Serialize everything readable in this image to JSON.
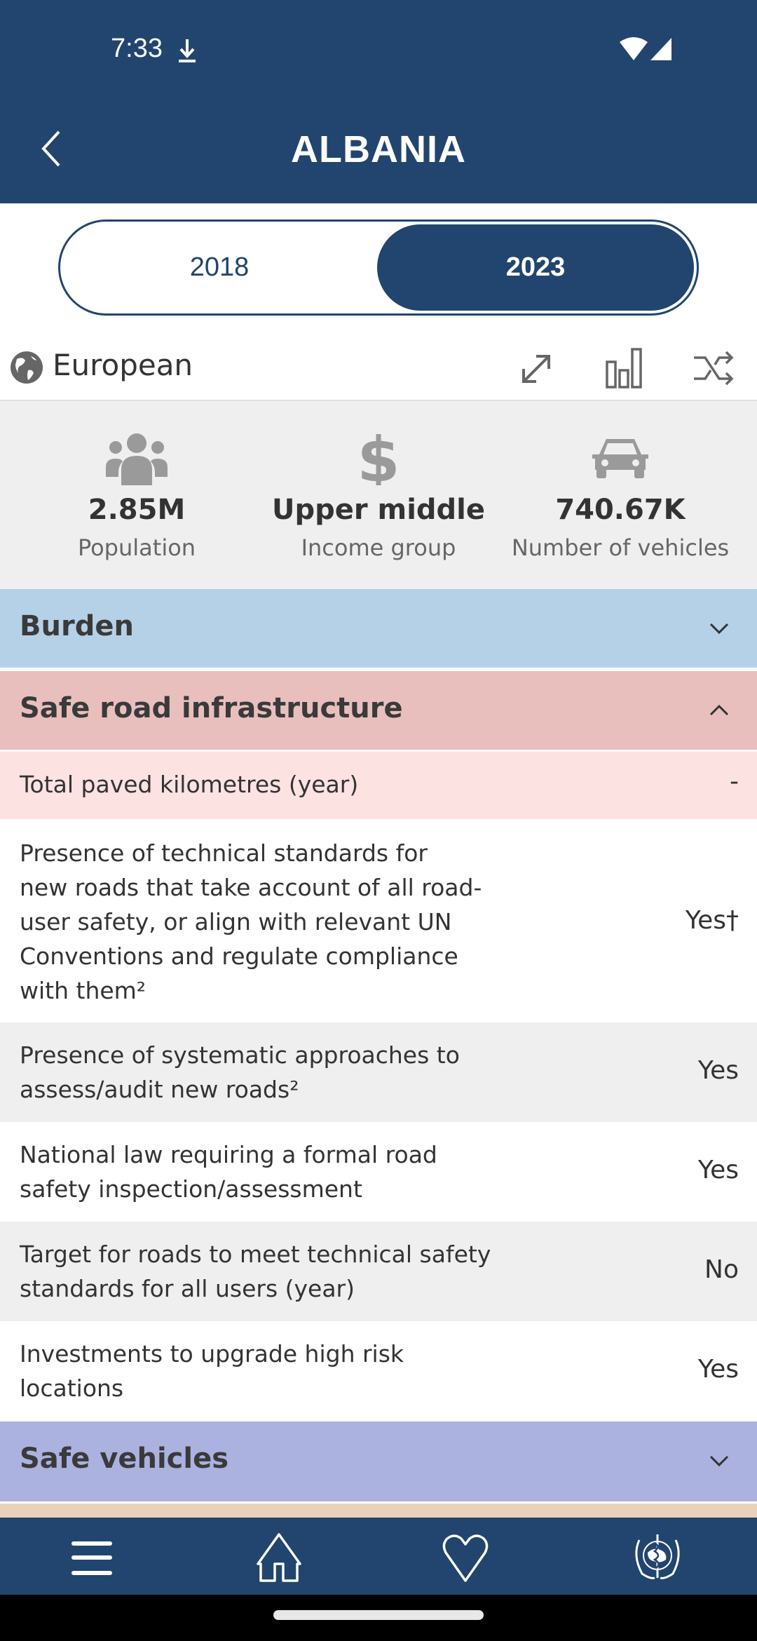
{
  "status_bar": {
    "time": "7:33",
    "icons": [
      "download-icon",
      "wifi-icon",
      "cell-signal-icon"
    ]
  },
  "app_bar": {
    "title": "ALBANIA",
    "back_icon": "chevron-left-icon"
  },
  "year_toggle": {
    "options": [
      "2018",
      "2023"
    ],
    "selected": "2023"
  },
  "region": {
    "icon": "globe-icon",
    "name": "European",
    "tools": [
      "expand-icon",
      "bar-chart-icon",
      "shuffle-icon"
    ]
  },
  "stats": [
    {
      "icon": "people-icon",
      "value": "2.85M",
      "label": "Population"
    },
    {
      "icon": "dollar-icon",
      "value": "Upper middle",
      "label": "Income group"
    },
    {
      "icon": "car-icon",
      "value": "740.67K",
      "label": "Number of vehicles"
    }
  ],
  "sections": [
    {
      "title": "Burden",
      "expanded": false,
      "color": "#b5d1e8"
    },
    {
      "title": "Safe road infrastructure",
      "expanded": true,
      "color": "#e9bfbd",
      "rows": [
        {
          "label": "Total paved kilometres (year)",
          "value": "-"
        },
        {
          "label": "Presence of technical standards for new roads that take account of all road-user safety, or align with relevant UN Conventions and regulate compliance with them²",
          "value": "Yes†"
        },
        {
          "label": "Presence of systematic approaches to assess/audit new roads²",
          "value": "Yes"
        },
        {
          "label": "National law requiring a formal road safety inspection/assessment",
          "value": "Yes"
        },
        {
          "label": "Target for roads to meet technical safety standards for all users (year)",
          "value": "No"
        },
        {
          "label": "Investments to upgrade high risk locations",
          "value": "Yes"
        }
      ]
    },
    {
      "title": "Safe vehicles",
      "expanded": false,
      "color": "#abb2e0"
    }
  ],
  "bottom_nav": [
    "menu-icon",
    "home-icon",
    "heart-icon",
    "who-emblem-icon"
  ],
  "colors": {
    "primary": "#21456e",
    "burden": "#b5d1e8",
    "infrastructure_header": "#e9bfbd",
    "infrastructure_first_row": "#fde2e2",
    "vehicles": "#abb2e0",
    "next_section_peek": "#e8d2bb"
  }
}
